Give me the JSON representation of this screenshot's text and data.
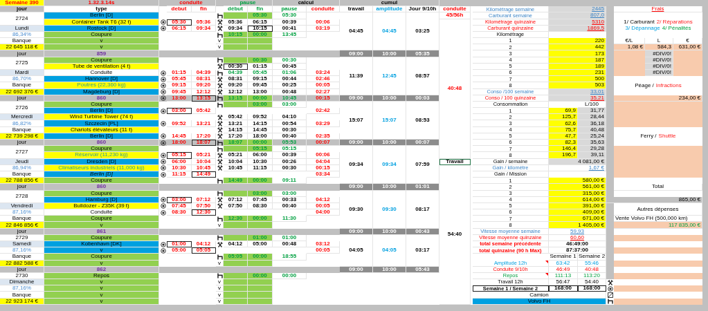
{
  "header": {
    "week": "Semaine 390",
    "version": "1.32.3.14s",
    "groups": [
      {
        "label": "conduite",
        "kind": "drive"
      },
      {
        "label": "pause",
        "kind": "pause"
      },
      {
        "label": "calcul",
        "kind": "calc"
      },
      {
        "label": "cumul",
        "kind": "calc"
      }
    ],
    "columns": [
      {
        "label": "jour",
        "kind": "day"
      },
      {
        "label": "type",
        "kind": "type"
      },
      {
        "label": "debut",
        "kind": "drive"
      },
      {
        "label": "fin",
        "kind": "drive"
      },
      {
        "label": "début",
        "kind": "pause"
      },
      {
        "label": "fin",
        "kind": "pause"
      },
      {
        "label": "pause",
        "kind": "pause"
      },
      {
        "label": "conduite",
        "kind": "drive"
      },
      {
        "label": "travail",
        "kind": "work"
      },
      {
        "label": "amplitude",
        "kind": "span"
      },
      {
        "label": "Jour 9/10h",
        "kind": "work"
      },
      {
        "label": "conduite",
        "kind": "drive"
      }
    ]
  },
  "days": [
    {
      "number": "2724",
      "name": "Lundi",
      "percent": "86,34%",
      "bank_label": "Banque",
      "bank": "22 645 118 €",
      "cumul": [
        "04:45",
        "04:45",
        "03:25"
      ],
      "rows": [
        {
          "type": "Berlin [D]",
          "kind": "city",
          "radio": false,
          "resting": true,
          "on_break": true,
          "pause_end": "05:30",
          "pause": "05:30"
        },
        {
          "type": "Container Tank T6 (32 t)",
          "kind": "cargo",
          "radio": true,
          "start": "05:30",
          "start_boxed": true,
          "end": "05:36",
          "working": true,
          "pause_start": "05:36",
          "pause_end": "06:15",
          "pause": "00:39",
          "drive": "00:06"
        },
        {
          "type": "Rostock [D]",
          "kind": "city",
          "radio": true,
          "start": "06:15",
          "end": "09:34",
          "working": true,
          "pause_start": "09:34",
          "pause_end": "10:15",
          "pause_end_boxed": true,
          "pause": "00:41",
          "drive": "03:19"
        },
        {
          "type": "Coupure",
          "kind": "break",
          "radio": false,
          "resting": true,
          "on_break": true,
          "pause_start": "10:15",
          "pause_end": "00:00",
          "pause": "13:45"
        },
        {
          "type": "v",
          "kind": "break",
          "radio": false,
          "note": "v",
          "on_break": true
        },
        {
          "type": "v",
          "kind": "break",
          "radio": false,
          "note": "v",
          "on_break": true
        }
      ],
      "separator": {
        "label": "jour",
        "value": "859",
        "totals": [
          "09:00",
          "10:00",
          "05:35"
        ]
      }
    },
    {
      "number": "2725",
      "name": "Mardi",
      "percent": "86,70%",
      "bank_label": "Banque",
      "bank": "22 692 376 €",
      "cumul": [
        "11:39",
        "12:45",
        "08:57"
      ],
      "rows": [
        {
          "type": "Coupure",
          "kind": "break",
          "radio": false,
          "resting": true,
          "on_break": true,
          "pause_end": "00:30",
          "pause": "00:30"
        },
        {
          "type": "Tube de ventilation (4 t)",
          "kind": "cargo",
          "radio": false,
          "working": true,
          "pause_start": "00:30",
          "pause_start_boxed": true,
          "pause_end": "01:15",
          "pause": "00:45"
        },
        {
          "type": "Conduite",
          "kind": "drive",
          "radio": true,
          "start": "01:15",
          "end": "04:39",
          "resting": true,
          "rest_pause": true,
          "pause_start": "04:39",
          "pause_end": "05:45",
          "pause": "01:06",
          "drive": "03:24"
        },
        {
          "type": "Hannover [D]",
          "kind": "city",
          "radio": true,
          "start": "05:45",
          "end": "08:31",
          "working": true,
          "pause_start": "08:31",
          "pause_end": "09:15",
          "pause": "00:44",
          "drive": "02:46"
        },
        {
          "type": "Poutres (22,360 kg)",
          "kind": "cargo",
          "highlight": true,
          "radio": true,
          "start": "09:15",
          "end": "09:20",
          "working": true,
          "pause_start": "09:20",
          "pause_end": "09:45",
          "pause": "00:25",
          "drive": "00:05"
        },
        {
          "type": "Magdeburg [D]",
          "kind": "city",
          "radio": true,
          "start": "09:45",
          "end": "12:12",
          "working": true,
          "pause_start": "12:12",
          "pause_end": "13:00",
          "pause": "00:48",
          "drive": "02:27"
        }
      ],
      "separator": {
        "label": "jour",
        "value": "860",
        "row": {
          "radio": true,
          "start": "13:00",
          "end": "13:15",
          "end_boxed": true,
          "resting": true,
          "on_break": true,
          "pause_start": "13:15",
          "pause_end": "00:00",
          "pause": "10:45",
          "drive": "00:15"
        },
        "totals": [
          "09:00",
          "10:00",
          "00:03"
        ]
      }
    },
    {
      "number": "2726",
      "name": "Mercredi",
      "percent": "86,82%",
      "bank_label": "Banque",
      "bank": "22 739 298 €",
      "cumul": [
        "15:07",
        "15:07",
        "08:53"
      ],
      "rows": [
        {
          "type": "Coupure",
          "kind": "break",
          "radio": false,
          "resting": true,
          "on_break": true,
          "pause_end": "03:00",
          "pause": "03:00"
        },
        {
          "type": "Berlin [D]",
          "kind": "city",
          "radio": true,
          "start": "03:00",
          "start_boxed": true,
          "end": "05:42",
          "drive": "02:42"
        },
        {
          "type": "Wind Turbine Tower (74 t)",
          "kind": "cargo",
          "radio": false,
          "working": true,
          "pause_start": "05:42",
          "pause_end": "09:52",
          "pause": "04:10"
        },
        {
          "type": "Szczecin [PL]",
          "kind": "city",
          "radio": true,
          "start": "09:52",
          "end": "13:21",
          "working": true,
          "pause_start": "13:21",
          "pause_end": "14:15",
          "pause": "00:54",
          "drive": "03:29"
        },
        {
          "type": "Chariots élévateurs (11 t)",
          "kind": "cargo",
          "radio": false,
          "working": true,
          "pause_start": "14:15",
          "pause_end": "14:45",
          "pause": "00:30"
        },
        {
          "type": "Berlin [D]",
          "kind": "city",
          "radio": true,
          "start": "14:45",
          "end": "17:20",
          "working": true,
          "pause_start": "17:20",
          "pause_end": "18:00",
          "pause": "00:40",
          "drive": "02:35"
        }
      ],
      "separator": {
        "label": "jour",
        "value": "860",
        "row": {
          "radio": true,
          "start": "18:00",
          "end": "18:07",
          "end_boxed": true,
          "resting": true,
          "on_break": true,
          "pause_start": "18:07",
          "pause_end": "00:00",
          "pause": "05:53",
          "drive": "00:07"
        },
        "totals": [
          "09:00",
          "10:00",
          "00:07"
        ]
      }
    },
    {
      "number": "2727",
      "name": "Jeudi",
      "percent": "86,94%",
      "bank_label": "Banque",
      "bank": "22 788 856 €",
      "cumul": [
        "09:34",
        "09:34",
        "07:59"
      ],
      "rows": [
        {
          "type": "Coupure",
          "kind": "break",
          "radio": false,
          "resting": true,
          "on_break": true,
          "pause_end": "05:15",
          "pause": "05:15"
        },
        {
          "type": "Réservoir (11,230 kg)",
          "kind": "cargo",
          "highlight": true,
          "radio": true,
          "start": "05:15",
          "start_boxed": true,
          "end": "05:21",
          "working": true,
          "pause_start": "05:21",
          "pause_end": "06:00",
          "pause": "00:39",
          "drive": "00:06"
        },
        {
          "type": "Dresden [D]",
          "kind": "city",
          "radio": true,
          "start": "06:00",
          "end": "10:04",
          "working": true,
          "pause_start": "10:04",
          "pause_end": "10:30",
          "pause": "00:26",
          "drive": "04:04"
        },
        {
          "type": "Climatiseurs industriels (11,000 kg)",
          "kind": "cargo",
          "highlight": true,
          "radio": true,
          "start": "10:30",
          "end": "10:45",
          "working": true,
          "pause_start": "10:45",
          "pause_end": "11:15",
          "pause": "00:30",
          "drive": "00:15"
        },
        {
          "type": "Berlin [D]",
          "kind": "city",
          "italic": true,
          "radio": true,
          "start": "11:15",
          "end": "14:49",
          "end_boxed": true,
          "drive": "03:34"
        },
        {
          "type": "Coupure",
          "kind": "break",
          "radio": false,
          "resting": true,
          "on_break": true,
          "pause_start": "14:49",
          "pause_end": "00:00",
          "pause": "09:11"
        }
      ],
      "separator": {
        "label": "jour",
        "value": "860",
        "totals": [
          "09:00",
          "10:00",
          "01:01"
        ]
      }
    },
    {
      "number": "2728",
      "name": "Vendredi",
      "percent": "87,16%",
      "bank_label": "Banque",
      "bank": "22 846 856 €",
      "cumul": [
        "09:30",
        "09:30",
        "08:17"
      ],
      "rows": [
        {
          "type": "Coupure",
          "kind": "break",
          "radio": false,
          "resting": true,
          "on_break": true,
          "pause_end": "03:00",
          "pause": "03:00"
        },
        {
          "type": "Hamburg [D]",
          "kind": "city",
          "radio": true,
          "start": "03:00",
          "start_boxed": true,
          "end": "07:12",
          "working": true,
          "pause_start": "07:12",
          "pause_end": "07:45",
          "pause": "00:33",
          "drive": "04:12"
        },
        {
          "type": "Bulldozer - Z35K (39 t)",
          "kind": "cargo",
          "radio": true,
          "start": "07:45",
          "end": "07:50",
          "working": true,
          "pause_start": "07:50",
          "pause_end": "08:30",
          "pause": "00:40",
          "drive": "00:05"
        },
        {
          "type": "Conduite",
          "kind": "drive",
          "radio": true,
          "start": "08:30",
          "end": "12:30",
          "end_boxed": true,
          "drive": "04:00"
        },
        {
          "type": "Coupure",
          "kind": "break",
          "radio": false,
          "resting": true,
          "on_break": true,
          "pause_start": "12:30",
          "pause_end": "00:00",
          "pause": "11:30"
        },
        {
          "type": "v",
          "kind": "break",
          "radio": false,
          "note": "v",
          "on_break": true
        }
      ],
      "separator": {
        "label": "jour",
        "value": "861",
        "totals": [
          "09:00",
          "10:00",
          "00:43"
        ]
      }
    },
    {
      "number": "2729",
      "name": "Samedi",
      "percent": "87,16%",
      "bank_label": "Banque",
      "bank": "22 882 588 €",
      "cumul": [
        "04:05",
        "04:05",
        "03:17"
      ],
      "rows": [
        {
          "type": "Coupure",
          "kind": "break",
          "radio": false,
          "resting": true,
          "on_break": true,
          "pause_end": "01:00",
          "pause": "01:00"
        },
        {
          "type": "Kobenhavn [DK]",
          "kind": "city",
          "radio": true,
          "start": "01:00",
          "start_boxed": true,
          "end": "04:12",
          "working": true,
          "pause_start": "04:12",
          "pause_end": "05:00",
          "pause": "00:48",
          "drive": "03:12"
        },
        {
          "type": "v",
          "kind": "city",
          "radio": true,
          "start": "05:00",
          "end": "05:05",
          "end_boxed": true,
          "drive": "00:05"
        },
        {
          "type": "Coupure",
          "kind": "break",
          "radio": false,
          "resting": true,
          "on_break": true,
          "pause_start": "05:05",
          "pause_end": "00:00",
          "pause": "18:55"
        },
        {
          "type": "v",
          "kind": "break",
          "radio": false,
          "note": "v",
          "on_break": true
        }
      ],
      "separator": {
        "label": "jour",
        "value": "862",
        "totals": [
          "09:00",
          "10:00",
          "05:43"
        ]
      }
    },
    {
      "number": "2730",
      "name": "Dimanche",
      "percent": "87,16%",
      "bank_label": "Banque",
      "bank": "22 923 174 €",
      "rows": [
        {
          "type": "Repos",
          "kind": "break",
          "radio": false,
          "resting": true,
          "on_break": true,
          "pause_end": "00:00",
          "pause": "00:00"
        },
        {
          "type": "v",
          "kind": "break",
          "radio": false,
          "note": "v",
          "on_break": true
        },
        {
          "type": "v",
          "kind": "break",
          "radio": false,
          "note": "v",
          "on_break": true
        },
        {
          "type": "v",
          "kind": "break",
          "radio": false,
          "note": "v",
          "on_break": true
        },
        {
          "type": "v",
          "kind": "break",
          "radio": false,
          "note": "v",
          "on_break": true
        }
      ]
    }
  ],
  "drive_column": {
    "limit": "45/56h",
    "blocks": [
      {
        "text": "40:48",
        "kind": "drive"
      },
      {
        "text": "Travail",
        "kind": "status"
      },
      {
        "text": "54:40",
        "kind": "work"
      }
    ]
  },
  "stats": {
    "distance": [
      {
        "label": "Kilométrage semaine",
        "value": "2445",
        "kind": "week"
      },
      {
        "label": "Carburant semaine",
        "value": "807,0",
        "kind": "week"
      },
      {
        "label": "Kilométrage quinzaine",
        "value": "5310",
        "kind": "fortnight"
      },
      {
        "label": "Carburant quinzaine",
        "value": "1869,5",
        "kind": "fortnight"
      }
    ],
    "km_title": "Kilométrage",
    "km": [
      {
        "index": "1",
        "value": "220"
      },
      {
        "index": "2",
        "value": "442"
      },
      {
        "index": "3",
        "value": "173"
      },
      {
        "index": "4",
        "value": "187"
      },
      {
        "index": "5",
        "value": "189"
      },
      {
        "index": "6",
        "value": "231"
      },
      {
        "index": "7",
        "value": "500"
      },
      {
        "index": "8",
        "value": "503"
      }
    ],
    "conso": [
      {
        "label": "Conso /100 semaine",
        "value": "33,01",
        "kind": "week"
      },
      {
        "label": "Conso / 100 quinzaine",
        "value": "35,21",
        "kind": "fortnight"
      }
    ],
    "consumption": {
      "title": "Consommation",
      "unit": "L/100",
      "items": [
        {
          "index": "1",
          "litres": "69,9",
          "per100": "31,77"
        },
        {
          "index": "2",
          "litres": "125,7",
          "per100": "28,44"
        },
        {
          "index": "3",
          "litres": "62,6",
          "per100": "36,18"
        },
        {
          "index": "4",
          "litres": "75,7",
          "per100": "40,48"
        },
        {
          "index": "5",
          "litres": "47,7",
          "per100": "25,24"
        },
        {
          "index": "6",
          "litres": "82,3",
          "per100": "35,63"
        },
        {
          "index": "7",
          "litres": "146,4",
          "per100": "29,28"
        },
        {
          "index": "8",
          "litres": "196,7",
          "per100": "39,11"
        }
      ]
    },
    "gain": {
      "week_label": "Gain / semaine",
      "week": "4 081,00 €",
      "km_label": "Gain / kilomètre",
      "km": "1,67 €",
      "mission_title": "Gain / Mission",
      "missions": [
        {
          "index": "1",
          "value": "580,00 €"
        },
        {
          "index": "2",
          "value": "561,00 €"
        },
        {
          "index": "3",
          "value": "315,00 €"
        },
        {
          "index": "4",
          "value": "614,00 €"
        },
        {
          "index": "5",
          "value": "391,00 €"
        },
        {
          "index": "6",
          "value": "409,00 €"
        },
        {
          "index": "7",
          "value": "671,00 €"
        },
        {
          "index": "8",
          "value": "1 405,00 €"
        }
      ]
    },
    "speed": [
      {
        "label": "Vitesse moyenne semaine",
        "value": "59,93",
        "kind": "week"
      },
      {
        "label": "Vitesse moyenne quinzaine",
        "value": "60,60",
        "kind": "fortnight"
      }
    ],
    "totals": [
      {
        "label": "total semaine précédente",
        "value": "46:49:00"
      },
      {
        "label": "total quinzaine (90 h Max)",
        "value": "87:37:00"
      }
    ],
    "weeks": {
      "columns": [
        "Semaine 1",
        "Semaine 2"
      ],
      "rows": [
        {
          "label": "Amplitude 12h",
          "kind": "span",
          "comment": true,
          "values": [
            "63:42",
            "55:46"
          ]
        },
        {
          "label": "Conduite 9/10h",
          "kind": "drive",
          "comment": false,
          "values": [
            "46:49",
            "40:48"
          ]
        },
        {
          "label": "Repos",
          "kind": "rest",
          "comment": true,
          "values": [
            "111:13",
            "113:20"
          ]
        },
        {
          "label": "Travail 12h",
          "kind": "work",
          "comment": false,
          "values": [
            "56:47",
            "54:40"
          ]
        },
        {
          "label": "Semaine 1 / Semaine 2",
          "kind": "total",
          "comment": false,
          "values": [
            "168:00",
            "168:00"
          ]
        }
      ]
    },
    "truck": {
      "label": "Camion",
      "model": "Volvo FH"
    }
  },
  "costs": {
    "title": "Frais",
    "legend": [
      [
        {
          "text": "1/ Carburant",
          "kind": "plain"
        },
        {
          "text": "2/ Réparations",
          "kind": "alert"
        }
      ],
      [
        {
          "text": "3/ Dépannage",
          "kind": "info"
        },
        {
          "text": "4/ Pénalités",
          "kind": "ok"
        }
      ]
    ],
    "fuel_columns": [
      "€/L",
      "L",
      "€"
    ],
    "fuel": [
      {
        "price": "1,08 €",
        "litres": "584,3",
        "total": "631,00 €"
      },
      {
        "litres": "#DIV/0!"
      },
      {
        "litres": "#DIV/0!"
      },
      {
        "litres": "#DIV/0!"
      },
      {
        "litres": "#DIV/0!"
      }
    ],
    "tolls": {
      "parts": [
        {
          "text": "Péage /",
          "kind": "plain"
        },
        {
          "text": "Infractions",
          "kind": "alert"
        }
      ],
      "amount": "234,00 €"
    },
    "ferry": {
      "parts": [
        {
          "text": "Ferry /",
          "kind": "plain"
        },
        {
          "text": "Shuttle",
          "kind": "alert"
        }
      ]
    },
    "total": {
      "label": "Total",
      "amount": "865,00 €"
    },
    "other": {
      "title": "Autres dépenses",
      "items": [
        {
          "label": "Vente Volvo FH (500,000 km)",
          "amount": "117 835,00 €"
        }
      ]
    }
  }
}
